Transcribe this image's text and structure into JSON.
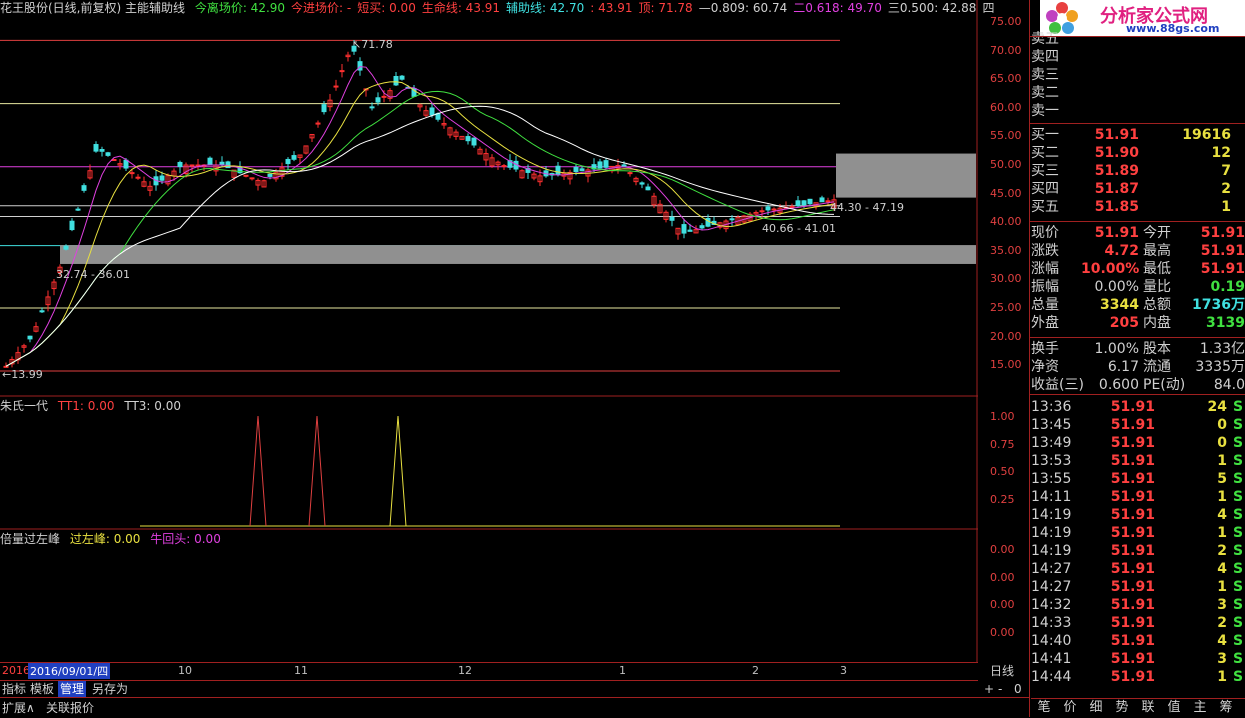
{
  "header": {
    "title": "花王股份(日线,前复权) 主能辅助线",
    "items": [
      {
        "label": "今离场价: 42.90",
        "color": "#40e040"
      },
      {
        "label": "今进场价: -",
        "color": "#ff4040"
      },
      {
        "label": "短买: 0.00",
        "color": "#ff4040"
      },
      {
        "label": "生命线: 43.91",
        "color": "#ff4040"
      },
      {
        "label": "辅助线: 42.70",
        "color": "#40e0e0"
      },
      {
        "label": ": 43.91",
        "color": "#ff4040"
      },
      {
        "label": "顶: 71.78",
        "color": "#ff4040"
      },
      {
        "label": "—0.809: 60.74",
        "color": "#d0d0d0"
      },
      {
        "label": "二0.618: 49.70",
        "color": "#e040e0"
      },
      {
        "label": "三0.500: 42.88",
        "color": "#d0d0d0"
      },
      {
        "label": "四",
        "color": "#d0d0d0"
      }
    ]
  },
  "price_axis": [
    "75.00",
    "70.00",
    "65.00",
    "60.00",
    "55.00",
    "50.00",
    "45.00",
    "40.00",
    "35.00",
    "30.00",
    "25.00",
    "20.00",
    "15.00"
  ],
  "annotations": {
    "high": "71.78",
    "low": "13.99",
    "range1": "32.74 - 36.01",
    "range2": "40.66 - 41.01",
    "range3": "44.30 - 47.19"
  },
  "panel2": {
    "title": "朱氏一代",
    "tt1": "TT1: 0.00",
    "tt3": "TT3: 0.00",
    "axis": [
      "1.00",
      "0.75",
      "0.50",
      "0.25"
    ]
  },
  "panel3": {
    "title": "倍量过左峰",
    "peak": "过左峰: 0.00",
    "bull": "牛回头: 0.00",
    "axis": [
      "0.00",
      "0.00",
      "0.00",
      "0.00"
    ]
  },
  "date_axis": {
    "year": "2016",
    "cursor_date": "2016/09/01/四",
    "ticks": [
      "10",
      "11",
      "12",
      "1",
      "2",
      "3"
    ],
    "period": "日线"
  },
  "bottom_tabs": [
    "指标",
    "模板",
    "管理",
    "另存为"
  ],
  "bottom_tabs2": [
    "扩展∧",
    "关联报价"
  ],
  "zoom_buttons": [
    "+",
    "-",
    "0"
  ],
  "logo": {
    "text": "分析家公式网",
    "url": "www.88gs.com"
  },
  "quote": {
    "sell": [
      {
        "label": "卖五"
      },
      {
        "label": "卖四"
      },
      {
        "label": "卖三"
      },
      {
        "label": "卖二"
      },
      {
        "label": "卖一"
      }
    ],
    "buy": [
      {
        "label": "买一",
        "price": "51.91",
        "vol": "19616"
      },
      {
        "label": "买二",
        "price": "51.90",
        "vol": "12"
      },
      {
        "label": "买三",
        "price": "51.89",
        "vol": "7"
      },
      {
        "label": "买四",
        "price": "51.87",
        "vol": "2"
      },
      {
        "label": "买五",
        "price": "51.85",
        "vol": "1"
      }
    ],
    "stats": [
      {
        "l1": "现价",
        "v1": "51.91",
        "l2": "今开",
        "v2": "51.91"
      },
      {
        "l1": "涨跌",
        "v1": "4.72",
        "l2": "最高",
        "v2": "51.91"
      },
      {
        "l1": "涨幅",
        "v1": "10.00%",
        "l2": "最低",
        "v2": "51.91"
      },
      {
        "l1": "振幅",
        "v1": "0.00%",
        "l2": "量比",
        "v2": "0.19"
      },
      {
        "l1": "总量",
        "v1": "3344",
        "l2": "总额",
        "v2": "1736万"
      },
      {
        "l1": "外盘",
        "v1": "205",
        "l2": "内盘",
        "v2": "3139"
      }
    ],
    "stats2": [
      {
        "l1": "换手",
        "v1": "1.00%",
        "l2": "股本",
        "v2": "1.33亿"
      },
      {
        "l1": "净资",
        "v1": "6.17",
        "l2": "流通",
        "v2": "3335万"
      },
      {
        "l1": "收益(三)",
        "v1": "0.600",
        "l2": "PE(动)",
        "v2": "84.0"
      }
    ],
    "ticks": [
      {
        "time": "13:36",
        "price": "51.91",
        "vol": "24",
        "flag": "S"
      },
      {
        "time": "13:45",
        "price": "51.91",
        "vol": "0",
        "flag": "S"
      },
      {
        "time": "13:49",
        "price": "51.91",
        "vol": "0",
        "flag": "S"
      },
      {
        "time": "13:53",
        "price": "51.91",
        "vol": "1",
        "flag": "S"
      },
      {
        "time": "13:55",
        "price": "51.91",
        "vol": "5",
        "flag": "S"
      },
      {
        "time": "14:11",
        "price": "51.91",
        "vol": "1",
        "flag": "S"
      },
      {
        "time": "14:19",
        "price": "51.91",
        "vol": "4",
        "flag": "S"
      },
      {
        "time": "14:19",
        "price": "51.91",
        "vol": "1",
        "flag": "S"
      },
      {
        "time": "14:19",
        "price": "51.91",
        "vol": "2",
        "flag": "S"
      },
      {
        "time": "14:27",
        "price": "51.91",
        "vol": "4",
        "flag": "S"
      },
      {
        "time": "14:27",
        "price": "51.91",
        "vol": "1",
        "flag": "S"
      },
      {
        "time": "14:32",
        "price": "51.91",
        "vol": "3",
        "flag": "S"
      },
      {
        "time": "14:33",
        "price": "51.91",
        "vol": "2",
        "flag": "S"
      },
      {
        "time": "14:40",
        "price": "51.91",
        "vol": "4",
        "flag": "S"
      },
      {
        "time": "14:41",
        "price": "51.91",
        "vol": "3",
        "flag": "S"
      },
      {
        "time": "14:44",
        "price": "51.91",
        "vol": "1",
        "flag": "S"
      }
    ],
    "tabs": [
      "笔",
      "价",
      "细",
      "势",
      "联",
      "值",
      "主",
      "筹"
    ]
  },
  "colors": {
    "up": "#ff3030",
    "down": "#40e0e0",
    "border": "#a02020"
  }
}
